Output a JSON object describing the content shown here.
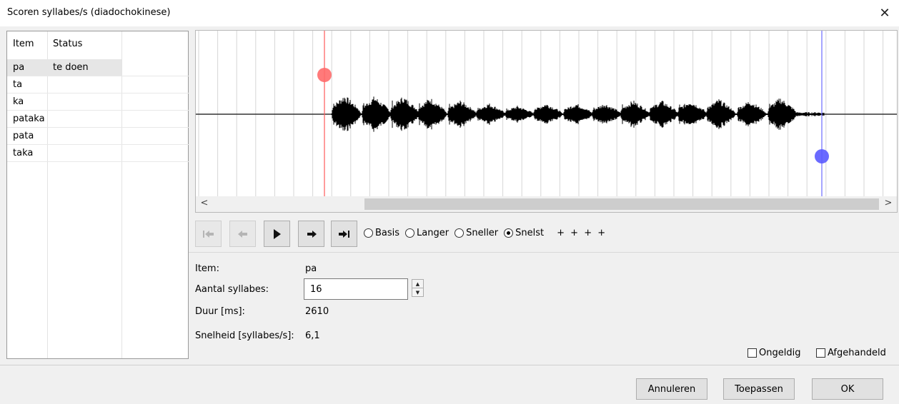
{
  "window": {
    "title": "Scoren syllabes/s (diadochokinese)",
    "close_glyph": "✕"
  },
  "item_list": {
    "columns": [
      "Item",
      "Status"
    ],
    "rows": [
      {
        "item": "pa",
        "status": "te doen"
      },
      {
        "item": "ta",
        "status": ""
      },
      {
        "item": "ka",
        "status": ""
      },
      {
        "item": "pataka",
        "status": ""
      },
      {
        "item": "pata",
        "status": ""
      },
      {
        "item": "taka",
        "status": ""
      }
    ],
    "selected_index": 0
  },
  "waveform": {
    "marker_start_color": "#ff4d4d",
    "marker_end_color": "#4a4aff",
    "scroll_left_glyph": "<",
    "scroll_right_glyph": ">"
  },
  "playback": {
    "buttons": [
      {
        "name": "go-start-button",
        "icon": "skip-start-icon",
        "enabled": false
      },
      {
        "name": "step-back-button",
        "icon": "arrow-left-icon",
        "enabled": false
      },
      {
        "name": "play-button",
        "icon": "play-icon",
        "enabled": true
      },
      {
        "name": "step-forward-button",
        "icon": "arrow-right-icon",
        "enabled": true
      },
      {
        "name": "go-end-button",
        "icon": "skip-end-icon",
        "enabled": true
      }
    ],
    "speeds": [
      {
        "label": "Basis",
        "selected": false
      },
      {
        "label": "Langer",
        "selected": false
      },
      {
        "label": "Sneller",
        "selected": false
      },
      {
        "label": "Snelst",
        "selected": true
      }
    ],
    "pluses": "+ + + +"
  },
  "details": {
    "item_label": "Item:",
    "item_value": "pa",
    "syllables_label": "Aantal syllabes:",
    "syllables_value": "16",
    "duration_label": "Duur [ms]:",
    "duration_value": "2610",
    "speed_label": "Snelheid [syllabes/s]:",
    "speed_value": "6,1"
  },
  "checks": {
    "invalid_label": "Ongeldig",
    "invalid_checked": false,
    "handled_label": "Afgehandeld",
    "handled_checked": false
  },
  "footer": {
    "cancel_label": "Annuleren",
    "apply_label": "Toepassen",
    "ok_label": "OK"
  }
}
